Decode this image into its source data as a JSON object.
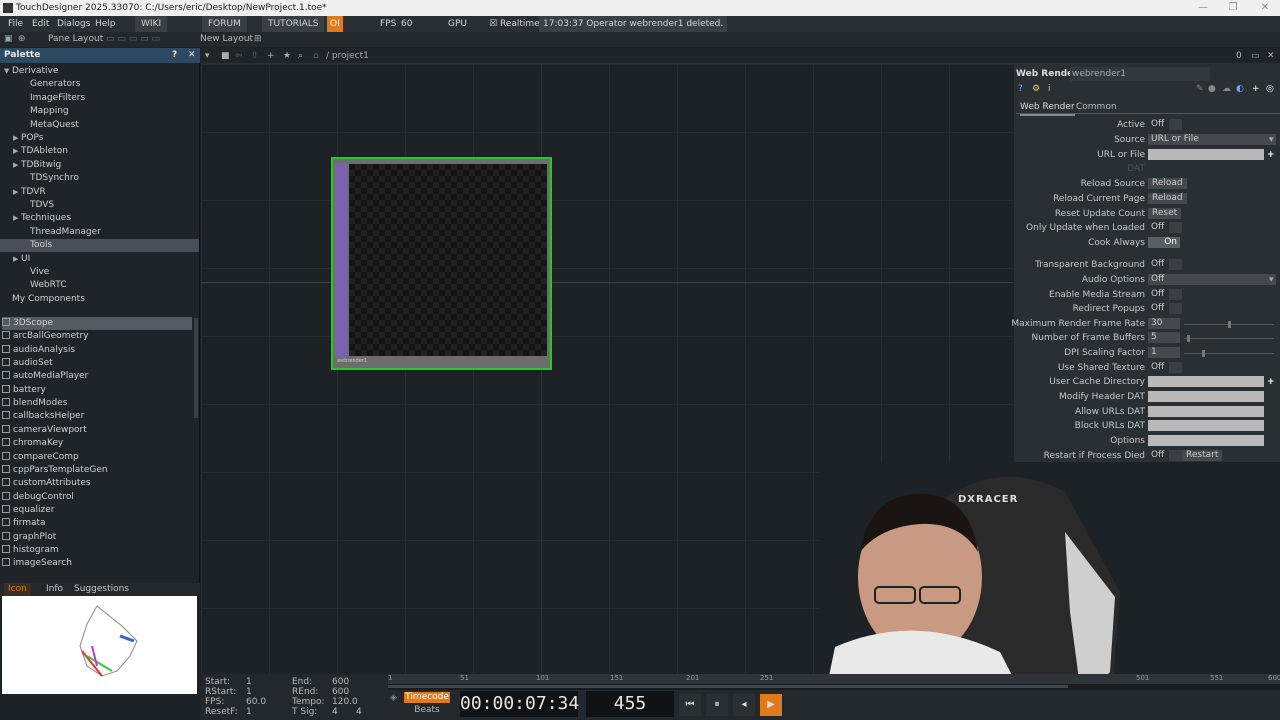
{
  "window": {
    "title": "TouchDesigner 2025.33070: C:/Users/eric/Desktop/NewProject.1.toe*",
    "controls": [
      "—",
      "❐",
      "✕"
    ]
  },
  "menubar": {
    "menus": [
      "File",
      "Edit",
      "Dialogs",
      "Help"
    ],
    "links": [
      "WIKI",
      "FORUM",
      "TUTORIALS"
    ],
    "oi": "OI",
    "fps_label": "FPS",
    "fps_value": "60",
    "gpu": "GPU",
    "realtime": "Realtime",
    "status": "17:03:37 Operator webrender1 deleted."
  },
  "toolbar2": {
    "pane_layout": "Pane Layout",
    "new_layout": "New Layout"
  },
  "network": {
    "path": "/ project1",
    "counter": "0"
  },
  "palette": {
    "title": "Palette",
    "tree": [
      {
        "label": "Derivative",
        "indent": 0,
        "expander": "▼"
      },
      {
        "label": "Generators",
        "indent": 2,
        "expander": ""
      },
      {
        "label": "ImageFilters",
        "indent": 2,
        "expander": ""
      },
      {
        "label": "Mapping",
        "indent": 2,
        "expander": ""
      },
      {
        "label": "MetaQuest",
        "indent": 2,
        "expander": ""
      },
      {
        "label": "POPs",
        "indent": 1,
        "expander": "▶"
      },
      {
        "label": "TDAbleton",
        "indent": 1,
        "expander": "▶"
      },
      {
        "label": "TDBitwig",
        "indent": 1,
        "expander": "▶"
      },
      {
        "label": "TDSynchro",
        "indent": 2,
        "expander": ""
      },
      {
        "label": "TDVR",
        "indent": 1,
        "expander": "▶"
      },
      {
        "label": "TDVS",
        "indent": 2,
        "expander": ""
      },
      {
        "label": "Techniques",
        "indent": 1,
        "expander": "▶"
      },
      {
        "label": "ThreadManager",
        "indent": 2,
        "expander": ""
      },
      {
        "label": "Tools",
        "indent": 2,
        "expander": "",
        "selected": true
      },
      {
        "label": "UI",
        "indent": 1,
        "expander": "▶"
      },
      {
        "label": "Vive",
        "indent": 2,
        "expander": ""
      },
      {
        "label": "WebRTC",
        "indent": 2,
        "expander": ""
      },
      {
        "label": "My Components",
        "indent": 0,
        "expander": ""
      }
    ],
    "components": [
      "3DScope",
      "arcBallGeometry",
      "audioAnalysis",
      "audioSet",
      "autoMediaPlayer",
      "battery",
      "blendModes",
      "callbacksHelper",
      "cameraViewport",
      "chromaKey",
      "compareComp",
      "cppParsTemplateGen",
      "customAttributes",
      "debugControl",
      "equalizer",
      "firmata",
      "graphPlot",
      "histogram",
      "imageSearch"
    ],
    "selected_component": "3DScope",
    "preview_tabs": [
      "Icon",
      "Info",
      "Suggestions"
    ]
  },
  "node": {
    "name": "webrender1"
  },
  "params": {
    "op_type": "Web Render",
    "op_name": "webrender1",
    "tabs": [
      "Web Render",
      "Common"
    ],
    "rows": [
      {
        "label": "Active",
        "kind": "toggle",
        "value": "Off"
      },
      {
        "label": "Source",
        "kind": "menu",
        "value": "URL or File"
      },
      {
        "label": "URL or File",
        "kind": "field",
        "value": ""
      },
      {
        "label": "DAT",
        "kind": "ghost",
        "value": ""
      },
      {
        "label": "Reload Source",
        "kind": "button",
        "value": "Reload"
      },
      {
        "label": "Reload Current Page",
        "kind": "button",
        "value": "Reload"
      },
      {
        "label": "Reset Update Count",
        "kind": "button",
        "value": "Reset"
      },
      {
        "label": "Only Update when Loaded",
        "kind": "toggle",
        "value": "Off"
      },
      {
        "label": "Cook Always",
        "kind": "toggle-on",
        "value": "On"
      },
      {
        "label": "Transparent Background",
        "kind": "toggle",
        "value": "Off"
      },
      {
        "label": "Audio Options",
        "kind": "menu",
        "value": "Off"
      },
      {
        "label": "Enable Media Stream",
        "kind": "toggle",
        "value": "Off"
      },
      {
        "label": "Redirect Popups",
        "kind": "toggle",
        "value": "Off"
      },
      {
        "label": "Maximum Render Frame Rate",
        "kind": "slider",
        "value": "30"
      },
      {
        "label": "Number of Frame Buffers",
        "kind": "slider",
        "value": "5"
      },
      {
        "label": "DPI Scaling Factor",
        "kind": "slider",
        "value": "1"
      },
      {
        "label": "Use Shared Texture",
        "kind": "toggle",
        "value": "Off"
      },
      {
        "label": "User Cache Directory",
        "kind": "field",
        "value": ""
      },
      {
        "label": "Modify Header DAT",
        "kind": "field",
        "value": ""
      },
      {
        "label": "Allow URLs DAT",
        "kind": "field",
        "value": ""
      },
      {
        "label": "Block URLs DAT",
        "kind": "field",
        "value": ""
      },
      {
        "label": "Options",
        "kind": "field",
        "value": ""
      },
      {
        "label": "Restart if Process Died",
        "kind": "toggle-btn",
        "value": "Off",
        "button": "Restart"
      }
    ]
  },
  "timeline": {
    "start_label": "Start:",
    "start": "1",
    "end_label": "End:",
    "end": "600",
    "rstart_label": "RStart:",
    "rstart": "1",
    "rend_label": "REnd:",
    "rend": "600",
    "fps_label": "FPS:",
    "fps": "60.0",
    "tempo_label": "Tempo:",
    "tempo": "120.0",
    "resetf_label": "ResetF:",
    "resetf": "1",
    "tsig_label": "T Sig:",
    "tsig_a": "4",
    "tsig_b": "4",
    "ruler": [
      "1",
      "51",
      "101",
      "151",
      "201",
      "251",
      "501",
      "551",
      "600"
    ],
    "mode_timecode": "Timecode",
    "mode_beats": "Beats",
    "timecode": "00:00:07:34",
    "frame": "455"
  },
  "colors": {
    "node_border": "#28c828",
    "palette_header": "#2e4a63",
    "play_button": "#e07a1a"
  },
  "webcam_text": "DXRACER"
}
